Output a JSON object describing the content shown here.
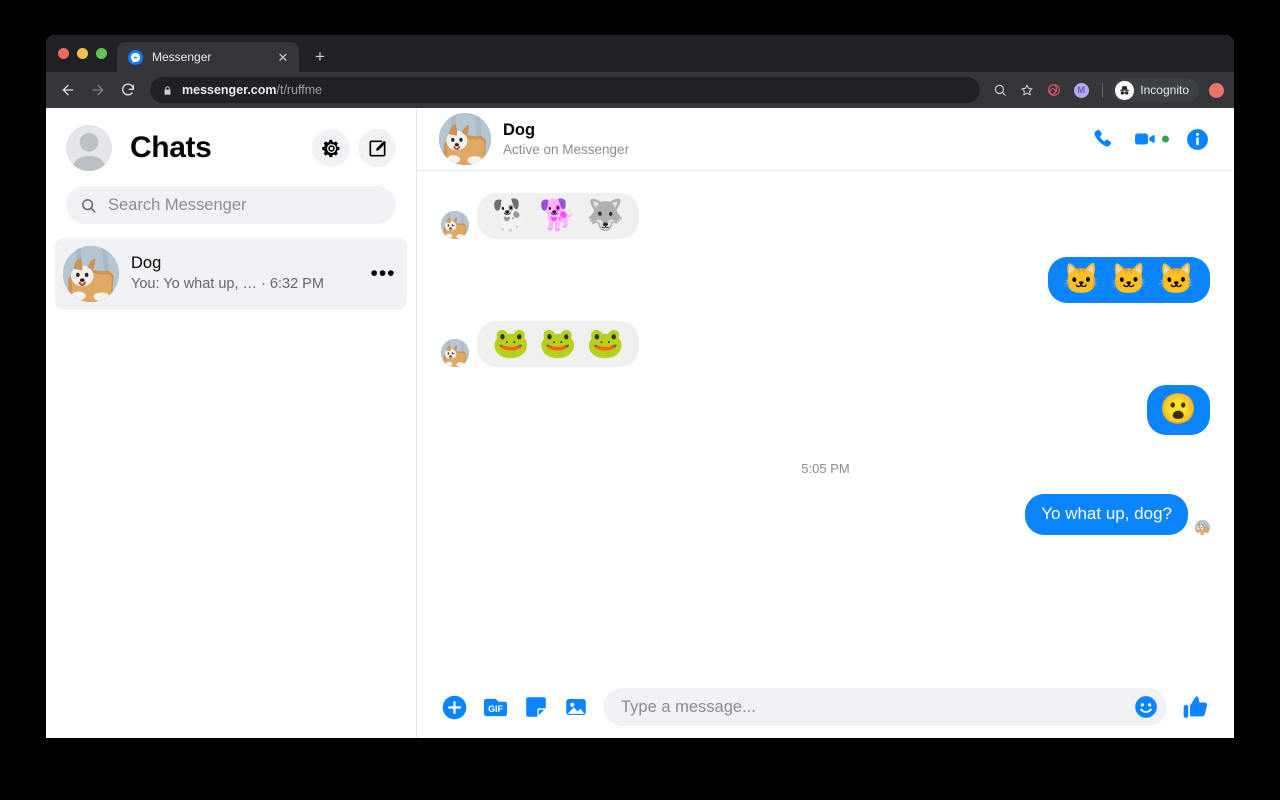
{
  "browser": {
    "traffic_lights": [
      "close",
      "minimize",
      "maximize"
    ],
    "tab": {
      "title": "Messenger",
      "favicon": "messenger-icon",
      "close_label": "✕"
    },
    "new_tab_label": "+",
    "nav": {
      "back": "back-arrow-icon",
      "forward": "forward-arrow-icon",
      "reload": "reload-icon"
    },
    "omnibox": {
      "lock": "lock-icon",
      "url_domain": "messenger.com",
      "url_path": "/t/ruffme"
    },
    "toolbar_icons": [
      "search-icon",
      "bookmark-star-icon",
      "extension-spiral-icon",
      "extension-purple-icon"
    ],
    "incognito": {
      "label": "Incognito",
      "icon": "incognito-hat-icon"
    },
    "profile_badge": "profile-avatar"
  },
  "sidebar": {
    "avatar": "default-user-avatar",
    "title": "Chats",
    "settings_icon": "gear-icon",
    "compose_icon": "compose-icon",
    "search": {
      "icon": "search-icon",
      "placeholder": "Search Messenger"
    },
    "conversations": [
      {
        "avatar": "dog-avatar",
        "name": "Dog",
        "preview": "You: Yo what up, …  · 6:32 PM",
        "more_label": "•••"
      }
    ]
  },
  "conversation": {
    "header": {
      "avatar": "dog-avatar",
      "name": "Dog",
      "status": "Active on Messenger",
      "actions": [
        "phone-call-icon",
        "video-call-icon",
        "info-icon"
      ],
      "active_indicator": true
    },
    "messages": [
      {
        "direction": "in",
        "type": "stickers",
        "avatar": "dog-avatar",
        "stickers": [
          "🐕",
          "🐕",
          "🐺"
        ]
      },
      {
        "direction": "out",
        "type": "stickers",
        "stickers": [
          "🐱",
          "🐱",
          "🐱"
        ]
      },
      {
        "direction": "in",
        "type": "stickers",
        "avatar": "dog-avatar",
        "stickers": [
          "🐸",
          "🐸",
          "🐸"
        ]
      },
      {
        "direction": "out",
        "type": "single-emoji",
        "stickers": [
          "😮"
        ]
      }
    ],
    "timestamp": "5:05 PM",
    "last_message": {
      "direction": "out",
      "text": "Yo what up, dog?",
      "receipt_avatar": "dog-avatar"
    }
  },
  "composer": {
    "icons": [
      "plus-circle-icon",
      "gif-icon",
      "sticker-icon",
      "photo-icon"
    ],
    "gif_label": "GIF",
    "input_placeholder": "Type a message...",
    "emoji_icon": "smiley-icon",
    "like_icon": "thumbs-up-icon"
  },
  "colors": {
    "messenger_blue": "#0a84ff",
    "incoming_bubble": "#f0f0f0",
    "sidebar_hover": "#f0f2f5",
    "active_green": "#31a24c",
    "browser_dark": "#202124",
    "browser_toolbar": "#35363a"
  }
}
